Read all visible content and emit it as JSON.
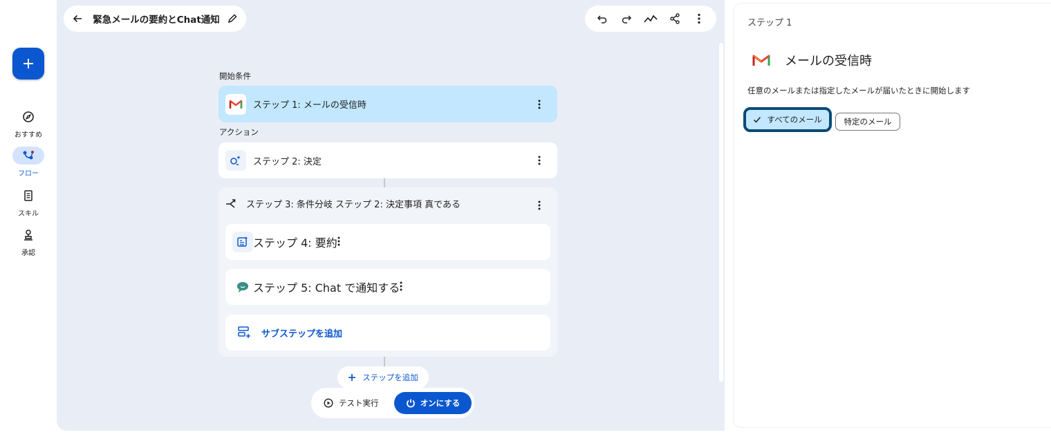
{
  "app": {
    "flow_title": "緊急メールの要約とChat通知"
  },
  "nav": {
    "items": [
      {
        "label": "おすすめ",
        "icon": "compass-icon"
      },
      {
        "label": "フロー",
        "icon": "flow-icon",
        "active": true
      },
      {
        "label": "スキル",
        "icon": "skill-icon"
      },
      {
        "label": "承認",
        "icon": "approval-icon"
      }
    ]
  },
  "canvas": {
    "trigger_label": "開始条件",
    "actions_label": "アクション",
    "steps": [
      {
        "label": "ステップ 1: メールの受信時",
        "icon": "gmail-icon"
      },
      {
        "label": "ステップ 2: 決定",
        "icon": "decide-icon"
      },
      {
        "label": "ステップ 3: 条件分岐 ステップ 2: 決定事項 真である",
        "icon": "branch-icon"
      },
      {
        "label": "ステップ 4: 要約",
        "icon": "summary-icon"
      },
      {
        "label": "ステップ 5: Chat で通知する",
        "icon": "chat-icon"
      }
    ],
    "add_substep_label": "サブステップを追加",
    "add_step_label": "ステップを追加",
    "test_run_label": "テスト実行",
    "turn_on_label": "オンにする"
  },
  "panel": {
    "step_number": "ステップ 1",
    "title": "メールの受信時",
    "description": "任意のメールまたは指定したメールが届いたときに開始します",
    "options": [
      {
        "label": "すべてのメール",
        "selected": true
      },
      {
        "label": "特定のメール",
        "selected": false
      }
    ]
  },
  "colors": {
    "accent": "#0b57d0",
    "selected_card": "#c2e7ff",
    "canvas_bg": "#e9eef6"
  }
}
